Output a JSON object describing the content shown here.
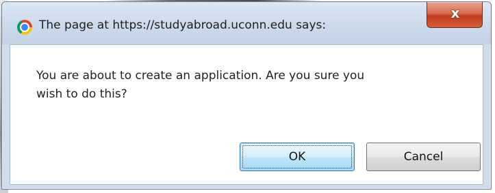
{
  "dialog": {
    "title": "The page at https://studyabroad.uconn.edu says:",
    "message": "You are about to create an application.  Are you sure you\nwish to do this?",
    "title_icon": "chrome-icon",
    "close_icon_glyph": "x",
    "buttons": {
      "ok_label": "OK",
      "cancel_label": "Cancel"
    }
  },
  "colors": {
    "frame": "#cfdcec",
    "close_button": "#c23a1c",
    "ok_button_focus": "#3c7fb1"
  }
}
